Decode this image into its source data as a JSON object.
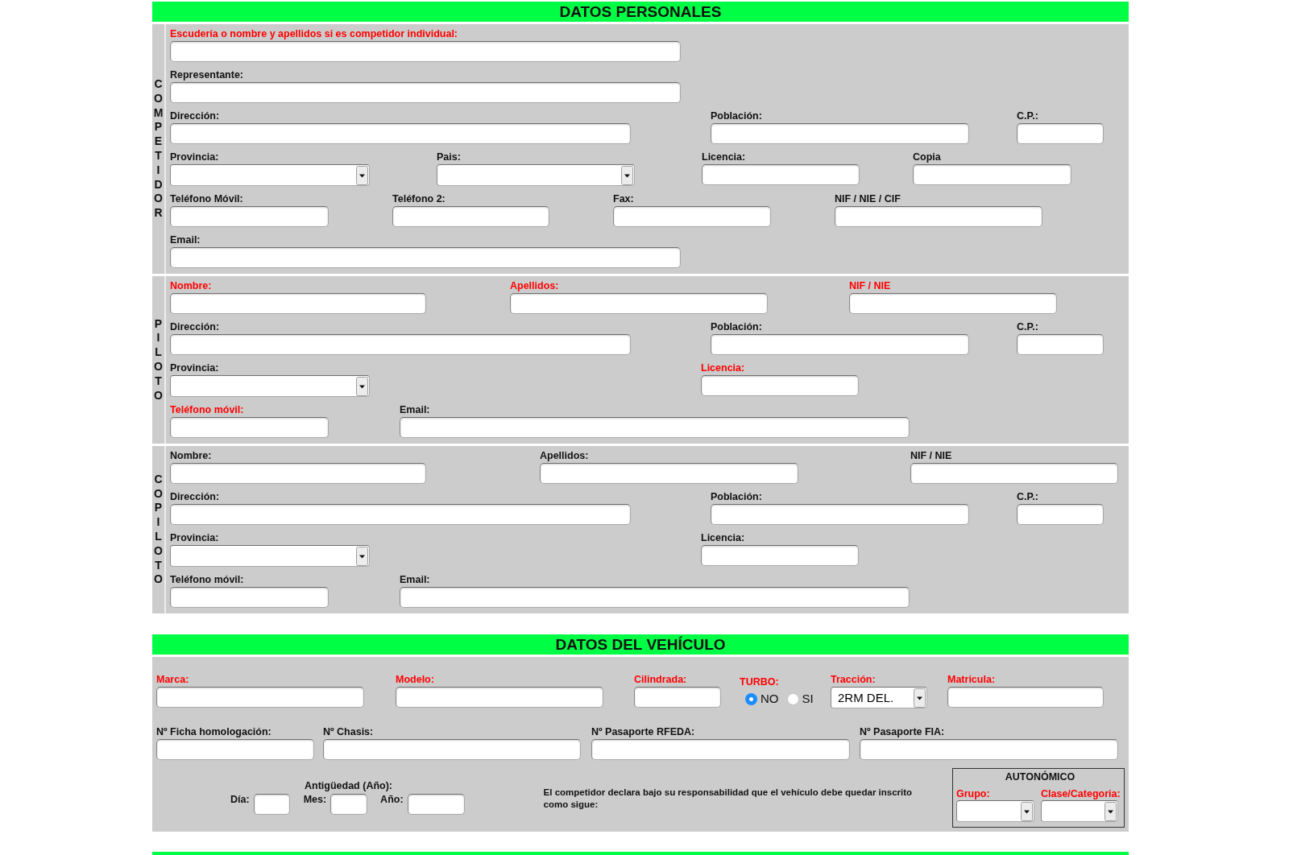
{
  "personal_data": {
    "title": "DATOS PERSONALES",
    "groups": [
      {
        "side_label": "COMPETIDOR",
        "rows": [
          [
            {
              "kind": "text",
              "label": "Escudería o nombre y apellidos si es competidor individual:",
              "required": true
            }
          ],
          [
            {
              "kind": "text",
              "label": "Representante:",
              "required": false
            }
          ],
          [
            {
              "kind": "text",
              "label": "Dirección:",
              "required": false
            },
            {
              "kind": "text",
              "label": "Población:",
              "required": false
            },
            {
              "kind": "text",
              "label": "C.P.:",
              "required": false
            }
          ],
          [
            {
              "kind": "select",
              "label": "Provincia:",
              "required": false
            },
            {
              "kind": "select",
              "label": "Pais:",
              "required": false
            },
            {
              "kind": "text",
              "label": "Licencia:",
              "required": false
            },
            {
              "kind": "text",
              "label": "Copia",
              "required": false
            }
          ],
          [
            {
              "kind": "text",
              "label": "Teléfono Móvil:",
              "required": false
            },
            {
              "kind": "text",
              "label": "Teléfono 2:",
              "required": false
            },
            {
              "kind": "text",
              "label": "Fax:",
              "required": false
            },
            {
              "kind": "text",
              "label": "NIF / NIE / CIF",
              "required": false
            }
          ],
          [
            {
              "kind": "text",
              "label": "Email:",
              "required": false
            }
          ]
        ]
      },
      {
        "side_label": "PILOTO",
        "rows": [
          [
            {
              "kind": "text",
              "label": "Nombre:",
              "required": true
            },
            {
              "kind": "text",
              "label": "Apellidos:",
              "required": true
            },
            {
              "kind": "text",
              "label": "NIF / NIE",
              "required": true
            }
          ],
          [
            {
              "kind": "text",
              "label": "Dirección:",
              "required": false
            },
            {
              "kind": "text",
              "label": "Población:",
              "required": false
            },
            {
              "kind": "text",
              "label": "C.P.:",
              "required": false
            }
          ],
          [
            {
              "kind": "select",
              "label": "Provincia:",
              "required": false
            },
            {
              "kind": "text",
              "label": "Licencia:",
              "required": true
            }
          ],
          [
            {
              "kind": "text",
              "label": "Teléfono móvil:",
              "required": true
            },
            {
              "kind": "text",
              "label": "Email:",
              "required": false
            }
          ]
        ]
      },
      {
        "side_label": "COPILOTO",
        "rows": [
          [
            {
              "kind": "text",
              "label": "Nombre:",
              "required": false
            },
            {
              "kind": "text",
              "label": "Apellidos:",
              "required": false
            },
            {
              "kind": "text",
              "label": "NIF / NIE",
              "required": false
            }
          ],
          [
            {
              "kind": "text",
              "label": "Dirección:",
              "required": false
            },
            {
              "kind": "text",
              "label": "Población:",
              "required": false
            },
            {
              "kind": "text",
              "label": "C.P.:",
              "required": false
            }
          ],
          [
            {
              "kind": "select",
              "label": "Provincia:",
              "required": false
            },
            {
              "kind": "text",
              "label": "Licencia:",
              "required": false
            }
          ],
          [
            {
              "kind": "text",
              "label": "Teléfono móvil:",
              "required": false
            },
            {
              "kind": "text",
              "label": "Email:",
              "required": false
            }
          ]
        ]
      }
    ]
  },
  "vehicle_data": {
    "title": "DATOS DEL VEHÍCULO",
    "rows": [
      [
        {
          "kind": "text",
          "label": "Marca:",
          "required": true
        },
        {
          "kind": "text",
          "label": "Modelo:",
          "required": true
        },
        {
          "kind": "text",
          "label": "Cilindrada:",
          "required": true
        },
        {
          "kind": "radio",
          "label": "TURBO:",
          "required": true,
          "options": [
            {
              "label": "NO",
              "selected": true
            },
            {
              "label": "SI",
              "selected": false
            }
          ]
        },
        {
          "kind": "select",
          "label": "Tracción:",
          "required": true,
          "value": "2RM DEL."
        },
        {
          "kind": "text",
          "label": "Matricula:",
          "required": true
        }
      ],
      [
        {
          "kind": "text",
          "label": "Nº Ficha homologación:",
          "required": false
        },
        {
          "kind": "text",
          "label": "Nº Chasis:",
          "required": false
        },
        {
          "kind": "text",
          "label": "Nº Pasaporte RFEDA:",
          "required": false
        },
        {
          "kind": "text",
          "label": "Nº Pasaporte FIA:",
          "required": false
        }
      ]
    ],
    "age": {
      "label": "Antigüedad (Año):",
      "fields": [
        {
          "label": "Día:",
          "required": false
        },
        {
          "label": "Mes:",
          "required": false
        },
        {
          "label": "Año:",
          "required": false
        }
      ]
    },
    "declaration": "El competidor declara bajo su responsabilidad que el vehículo debe quedar inscrito como sigue:",
    "regional": {
      "title": "AUTONÓMICO",
      "fields": [
        {
          "kind": "select",
          "label": "Grupo:",
          "required": true
        },
        {
          "kind": "select",
          "label": "Clase/Categoria:",
          "required": true
        }
      ]
    }
  }
}
